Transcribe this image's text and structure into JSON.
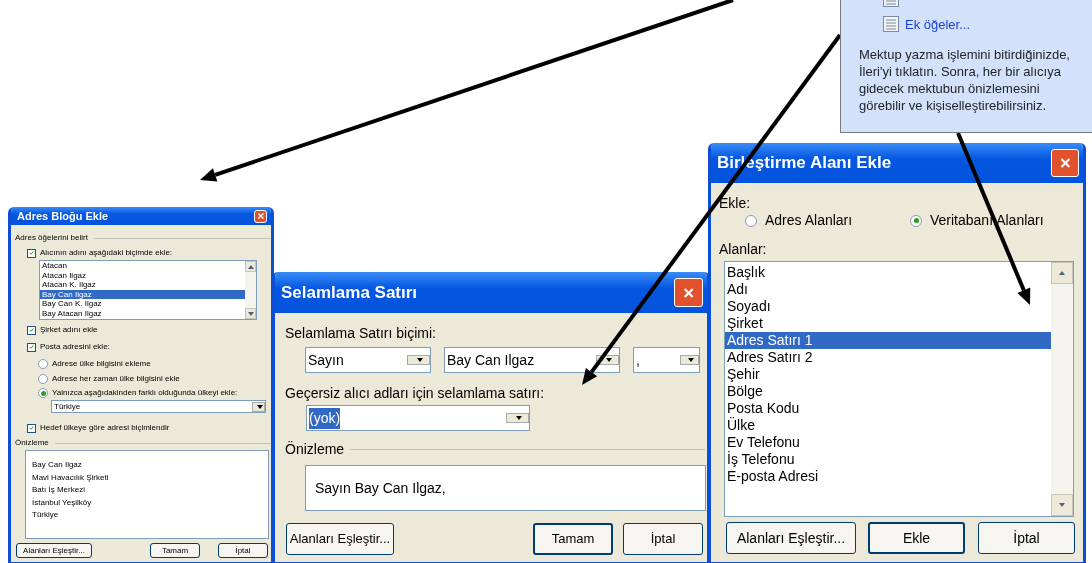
{
  "task_pane": {
    "link": "Ek öğeler...",
    "description": "Mektup yazma işlemini bitirdiğinizde, İleri'yi tıklatın. Sonra, her bir alıcıya gidecek mektubun önizlemesini görebilir ve kişiselleştirebilirsiniz."
  },
  "address_block_dialog": {
    "title": "Adres Bloğu Ekle",
    "group": "Adres öğelerini belirt",
    "name_checkbox": {
      "label": "Alıcının adını aşağıdaki biçimde ekle:",
      "checked": true
    },
    "name_formats": [
      {
        "label": "Atacan",
        "selected": false
      },
      {
        "label": "Atacan Ilgaz",
        "selected": false
      },
      {
        "label": "Atacan K. Ilgaz",
        "selected": false
      },
      {
        "label": "Bay Can Ilgaz",
        "selected": true
      },
      {
        "label": "Bay Can K. Ilgaz",
        "selected": false
      },
      {
        "label": "Bay Atacan Ilgaz",
        "selected": false
      }
    ],
    "company_checkbox": {
      "label": "Şirket adını ekle",
      "checked": true
    },
    "postal_checkbox": {
      "label": "Posta adresini ekle:",
      "checked": true
    },
    "country_options": [
      {
        "label": "Adrese ülke bilgisini ekleme",
        "selected": false
      },
      {
        "label": "Adrese her zaman ülke bilgisini ekle",
        "selected": false
      },
      {
        "label": "Yalnızca aşağıdakinden farklı olduğunda ülkeyi ekle:",
        "selected": true
      }
    ],
    "country": "Türkiye",
    "format_checkbox": {
      "label": "Hedef ülkeye göre adresi biçimlendir",
      "checked": true
    },
    "preview_label": "Önizleme",
    "preview_lines": [
      "Bay Can Ilgaz",
      "Mavi Havacılık Şirketi",
      "Batı İş Merkezi",
      "İstanbul Yeşilköy",
      "Türkiye"
    ],
    "buttons": [
      "Alanları Eşleştir...",
      "Tamam",
      "İptal"
    ]
  },
  "greeting_dialog": {
    "title": "Selamlama Satırı",
    "format_label": "Selamlama Satırı biçimi:",
    "format_values": [
      "Sayın",
      "Bay Can Ilgaz",
      ","
    ],
    "invalid_label": "Geçersiz alıcı adları için selamlama satırı:",
    "invalid_value": "(yok)",
    "preview_label": "Önizleme",
    "preview": "Sayın Bay Can Ilgaz,",
    "buttons": [
      "Alanları Eşleştir...",
      "Tamam",
      "İptal"
    ]
  },
  "merge_field_dialog": {
    "title": "Birleştirme Alanı Ekle",
    "insert_label": "Ekle:",
    "insert_options": [
      {
        "label": "Adres Alanları",
        "selected": false
      },
      {
        "label": "Veritabanı Alanları",
        "selected": true
      }
    ],
    "fields_label": "Alanlar:",
    "fields": [
      {
        "label": "Başlık",
        "selected": false
      },
      {
        "label": "Adı",
        "selected": false
      },
      {
        "label": "Soyadı",
        "selected": false
      },
      {
        "label": "Şirket",
        "selected": false
      },
      {
        "label": "Adres Satırı 1",
        "selected": true
      },
      {
        "label": "Adres Satırı 2",
        "selected": false
      },
      {
        "label": "Şehir",
        "selected": false
      },
      {
        "label": "Bölge",
        "selected": false
      },
      {
        "label": "Posta Kodu",
        "selected": false
      },
      {
        "label": "Ülke",
        "selected": false
      },
      {
        "label": "Ev Telefonu",
        "selected": false
      },
      {
        "label": "İş Telefonu",
        "selected": false
      },
      {
        "label": "E-posta Adresi",
        "selected": false
      }
    ],
    "buttons": [
      "Alanları Eşleştir...",
      "Ekle",
      "İptal"
    ]
  }
}
